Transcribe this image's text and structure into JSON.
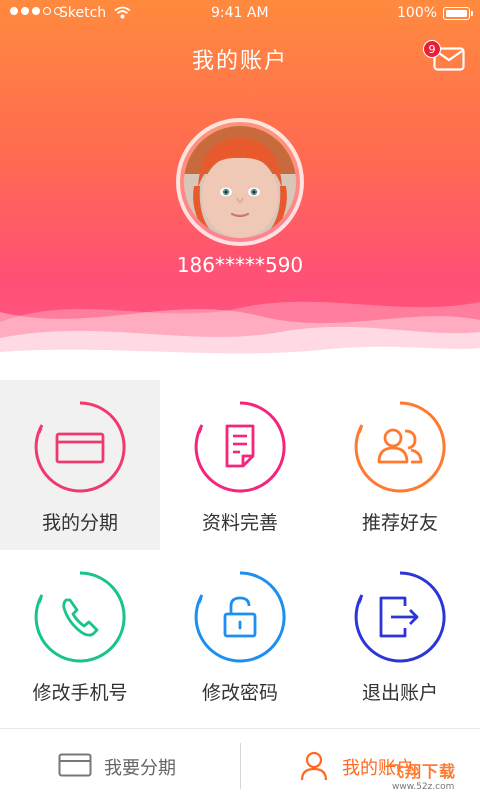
{
  "status_bar": {
    "carrier": "Sketch",
    "time": "9:41 AM",
    "battery": "100%"
  },
  "header": {
    "title": "我的账户",
    "message_count": "9",
    "phone": "186*****590",
    "colors": {
      "top": "#ff8a3d",
      "bottom": "#ff4f77"
    }
  },
  "menu": {
    "items": [
      {
        "label": "我的分期",
        "icon": "card-icon",
        "color": "#f03a6e"
      },
      {
        "label": "资料完善",
        "icon": "document-icon",
        "color": "#f4257b"
      },
      {
        "label": "推荐好友",
        "icon": "users-icon",
        "color": "#ff7a30"
      },
      {
        "label": "修改手机号",
        "icon": "phone-icon",
        "color": "#18c48a"
      },
      {
        "label": "修改密码",
        "icon": "lock-icon",
        "color": "#1d8ff0"
      },
      {
        "label": "退出账户",
        "icon": "logout-icon",
        "color": "#2b35d8"
      }
    ]
  },
  "tabbar": {
    "tabs": [
      {
        "label": "我要分期",
        "icon": "card-outline-icon"
      },
      {
        "label": "我的账户",
        "icon": "person-icon"
      }
    ],
    "selected": "我的账户"
  },
  "watermark": {
    "text": "飞翔下载",
    "sub": "www.52z.com"
  }
}
